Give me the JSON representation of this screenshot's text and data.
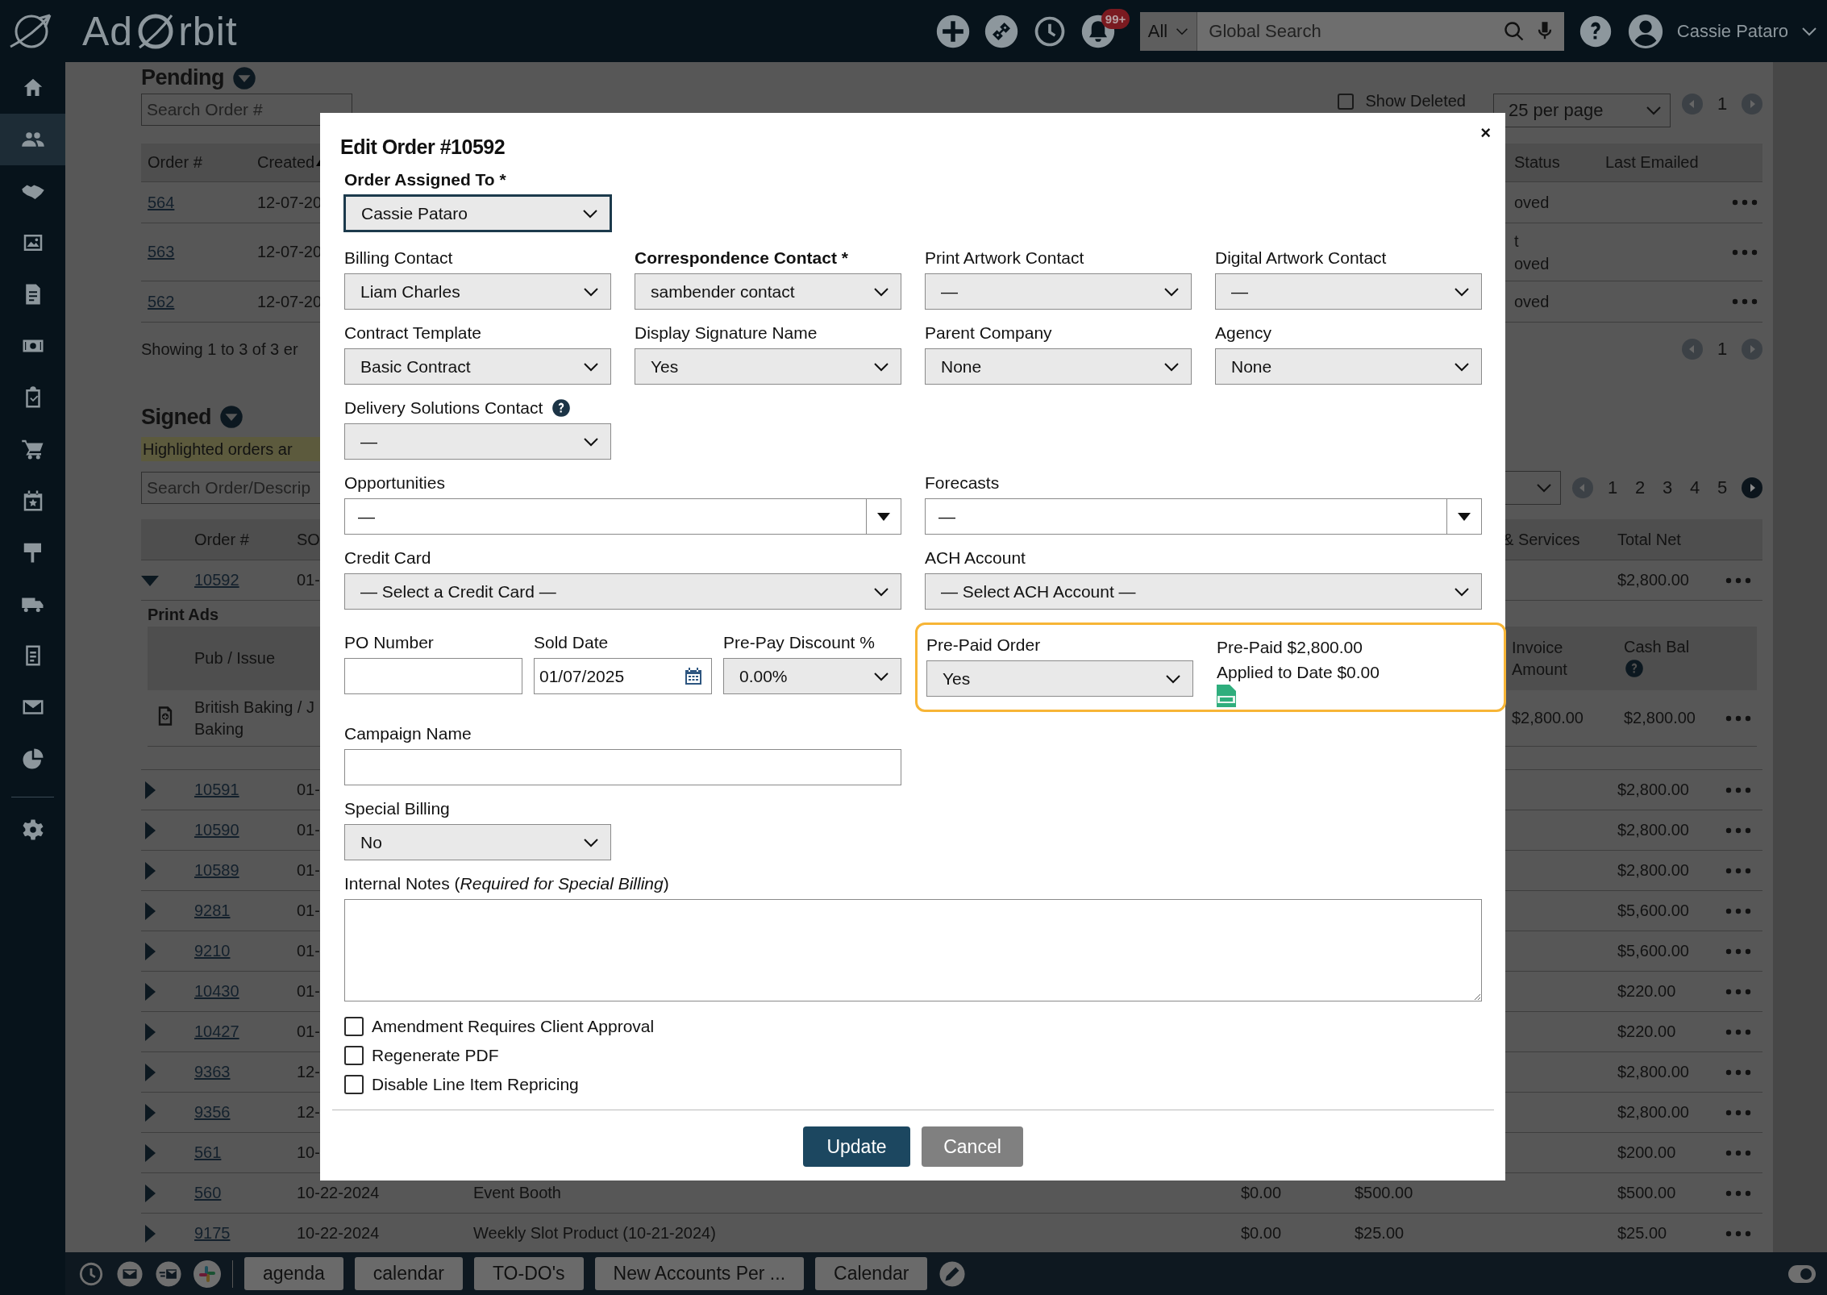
{
  "header": {
    "logo_left": "Ad",
    "logo_right": "rbit",
    "notification_badge": "99+",
    "search_scope": "All",
    "search_placeholder": "Global Search",
    "user_name": "Cassie Pataro"
  },
  "sidebar": {
    "items": [
      {
        "kind": "home",
        "selected": false
      },
      {
        "kind": "people",
        "selected": true
      },
      {
        "kind": "handshake",
        "selected": false
      },
      {
        "kind": "image",
        "selected": false
      },
      {
        "kind": "invoice",
        "selected": false
      },
      {
        "kind": "money",
        "selected": false
      },
      {
        "kind": "clipboard",
        "selected": false
      },
      {
        "kind": "cart",
        "selected": false
      },
      {
        "kind": "calendar",
        "selected": false
      },
      {
        "kind": "sign",
        "selected": false
      },
      {
        "kind": "truck",
        "selected": false
      },
      {
        "kind": "form",
        "selected": false
      },
      {
        "kind": "mail",
        "selected": false
      },
      {
        "kind": "chart",
        "selected": false
      },
      {
        "kind": "gear",
        "selected": false
      }
    ]
  },
  "pending": {
    "title": "Pending",
    "search_placeholder": "Search Order #",
    "show_deleted": {
      "label": "Show Deleted",
      "checked": false
    },
    "per_page": "25 per page",
    "top_pages": [
      "1"
    ],
    "columns": {
      "order": "Order #",
      "created": "Created",
      "status": "Status",
      "emailed": "Last Emailed"
    },
    "rows": [
      {
        "order": "564",
        "created": "12-07-20",
        "status": [
          "oved"
        ]
      },
      {
        "order": "563",
        "created": "12-07-20",
        "status": [
          "t",
          "oved"
        ]
      },
      {
        "order": "562",
        "created": "12-07-20",
        "status": [
          "oved"
        ]
      }
    ],
    "summary": "Showing 1 to 3 of 3 er",
    "bottom_pages": [
      "1"
    ]
  },
  "signed": {
    "title": "Signed",
    "notice": "Highlighted orders ar",
    "search_placeholder": "Search Order/Descrip",
    "pages": [
      "1",
      "2",
      "3",
      "4",
      "5"
    ],
    "prev_disabled": true,
    "next_disabled": false,
    "columns": {
      "order": "Order #",
      "date": "SO",
      "services": "& Services",
      "total": "Total Net"
    },
    "rows": [
      {
        "order": "10592",
        "expanded": true,
        "date": "01-",
        "total": "$2,800.00",
        "detail": {
          "section": "Print Ads",
          "columns": {
            "pub": "Pub / Issue",
            "invoice": "Invoice Amount",
            "cash": "Cash Bal"
          },
          "rows": [
            {
              "pub": [
                "British Baking / J",
                "Baking"
              ],
              "invoice": "$2,800.00",
              "cash": "$2,800.00"
            }
          ]
        }
      },
      {
        "order": "10591",
        "expanded": false,
        "date": "01-",
        "total": "$2,800.00"
      },
      {
        "order": "10590",
        "expanded": false,
        "date": "01-",
        "total": "$2,800.00"
      },
      {
        "order": "10589",
        "expanded": false,
        "date": "01-",
        "total": "$2,800.00"
      },
      {
        "order": "9281",
        "expanded": false,
        "date": "01-",
        "total": "$5,600.00"
      },
      {
        "order": "9210",
        "expanded": false,
        "date": "01-",
        "total": "$5,600.00"
      },
      {
        "order": "10430",
        "expanded": false,
        "date": "01-",
        "total": "$220.00"
      },
      {
        "order": "10427",
        "expanded": false,
        "date": "01-",
        "total": "$220.00"
      },
      {
        "order": "9363",
        "expanded": false,
        "date": "12-",
        "total": "$2,800.00"
      },
      {
        "order": "9356",
        "expanded": false,
        "date": "12-",
        "total": "$2,800.00"
      },
      {
        "order": "561",
        "expanded": false,
        "date": "10-",
        "total": "$200.00"
      },
      {
        "order": "560",
        "expanded": false,
        "date": "10-22-2024",
        "description": "Event Booth",
        "price": "$0.00",
        "amount": "$500.00",
        "total": "$500.00"
      },
      {
        "order": "9175",
        "expanded": false,
        "date": "10-22-2024",
        "description": "Weekly Slot Product (10-21-2024)",
        "price": "$0.00",
        "amount": "$25.00",
        "total": "$25.00"
      }
    ]
  },
  "modal": {
    "title": "Edit Order #10592",
    "close": "×",
    "assigned": {
      "label": "Order Assigned To *",
      "value": "Cassie Pataro",
      "focused": true
    },
    "grid_fields": [
      {
        "label": "Billing Contact",
        "value": "Liam Charles",
        "bold": false,
        "help": false
      },
      {
        "label": "Correspondence Contact *",
        "value": "sambender contact",
        "bold": true,
        "help": false
      },
      {
        "label": "Print Artwork Contact",
        "value": "—",
        "bold": false,
        "help": false
      },
      {
        "label": "Digital Artwork Contact",
        "value": "—",
        "bold": false,
        "help": false
      },
      {
        "label": "Contract Template",
        "value": "Basic Contract",
        "bold": false,
        "help": false
      },
      {
        "label": "Display Signature Name",
        "value": "Yes",
        "bold": false,
        "help": false
      },
      {
        "label": "Parent Company",
        "value": "None",
        "bold": false,
        "help": false
      },
      {
        "label": "Agency",
        "value": "None",
        "bold": false,
        "help": false
      },
      {
        "label": "Delivery Solutions Contact",
        "value": "—",
        "bold": false,
        "help": true
      }
    ],
    "wide_fields": [
      {
        "kind": "combo",
        "label": "Opportunities",
        "value": "—"
      },
      {
        "kind": "combo",
        "label": "Forecasts",
        "value": "—"
      },
      {
        "kind": "select",
        "label": "Credit Card",
        "value": "— Select a Credit Card —"
      },
      {
        "kind": "select",
        "label": "ACH Account",
        "value": "— Select ACH Account —"
      }
    ],
    "po_number": {
      "label": "PO Number"
    },
    "sold_date": {
      "label": "Sold Date",
      "value": "01/07/2025"
    },
    "discount": {
      "label": "Pre-Pay Discount %",
      "value": "0.00%"
    },
    "prepaid": {
      "label": "Pre-Paid Order",
      "value": "Yes",
      "highlighted": true,
      "lines": [
        "Pre-Paid $2,800.00",
        "Applied to Date $0.00"
      ]
    },
    "campaign": {
      "label": "Campaign Name"
    },
    "special_billing": {
      "label": "Special Billing",
      "value": "No"
    },
    "notes": {
      "label": "Internal Notes (*Required for Special Billing*)"
    },
    "checkboxes": [
      {
        "label": "Amendment Requires Client Approval",
        "checked": false
      },
      {
        "label": "Regenerate PDF",
        "checked": false
      },
      {
        "label": "Disable Line Item Repricing",
        "checked": false
      }
    ],
    "update": "Update",
    "cancel": "Cancel"
  },
  "taskbar": {
    "items": [
      "agenda",
      "calendar",
      "TO-DO's",
      "New Accounts Per ...",
      "Calendar"
    ]
  }
}
